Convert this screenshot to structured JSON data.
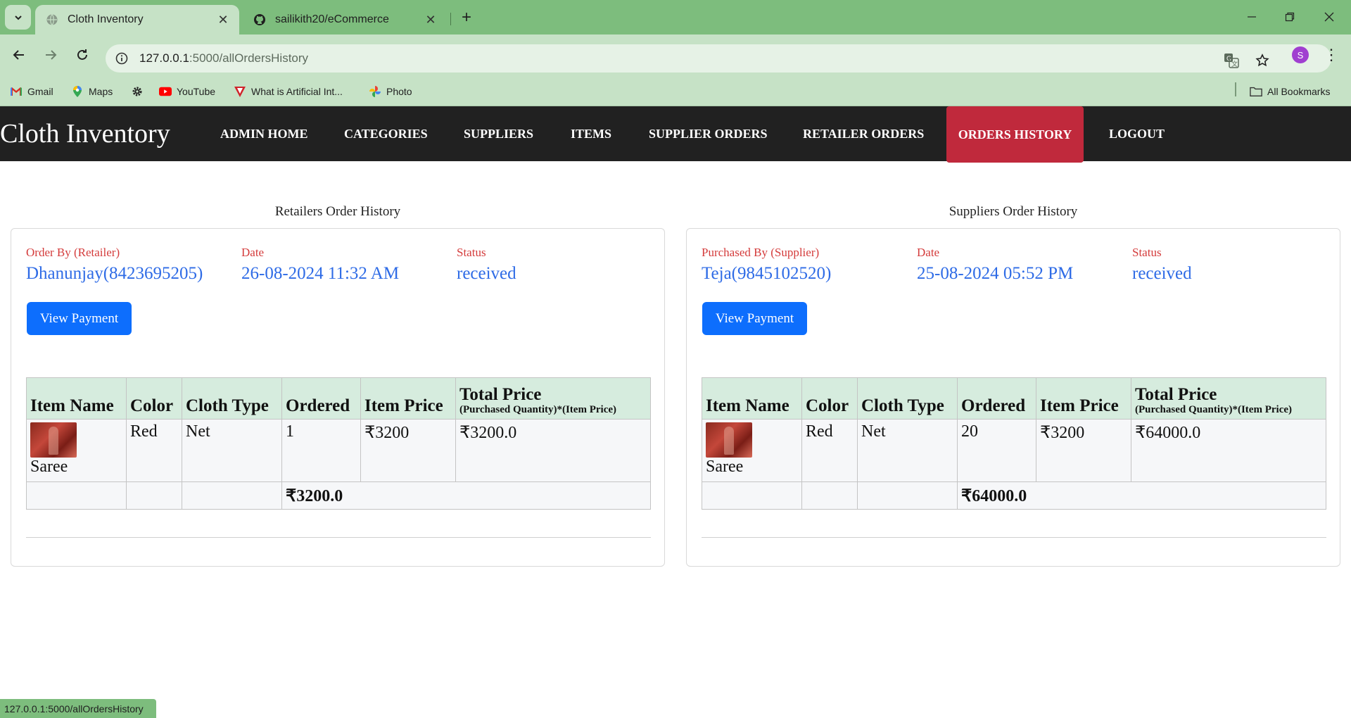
{
  "browser": {
    "tabs": [
      {
        "title": "Cloth Inventory",
        "active": true,
        "icon": "globe-icon"
      },
      {
        "title": "sailikith20/eCommerce",
        "active": false,
        "icon": "github-icon"
      }
    ],
    "url_host": "127.0.0.1",
    "url_path": ":5000/allOrdersHistory",
    "profile_initial": "S",
    "bookmarks": [
      {
        "label": "Gmail",
        "icon": "gmail-icon"
      },
      {
        "label": "Maps",
        "icon": "maps-icon"
      },
      {
        "label": "",
        "icon": "gear-icon"
      },
      {
        "label": "YouTube",
        "icon": "youtube-icon"
      },
      {
        "label": "What is Artificial Int...",
        "icon": "bookmark-v-icon"
      },
      {
        "label": "Photo",
        "icon": "photos-icon"
      }
    ],
    "all_bookmarks": "All Bookmarks",
    "status_url": "127.0.0.1:5000/allOrdersHistory",
    "accent": "#7dbd7d"
  },
  "app": {
    "brand": "Cloth Inventory",
    "nav": [
      {
        "label": "ADMIN HOME",
        "active": false
      },
      {
        "label": "CATEGORIES",
        "active": false
      },
      {
        "label": "SUPPLIERS",
        "active": false
      },
      {
        "label": "ITEMS",
        "active": false
      },
      {
        "label": "SUPPLIER ORDERS",
        "active": false
      },
      {
        "label": "RETAILER ORDERS",
        "active": false
      },
      {
        "label": "ORDERS HISTORY",
        "active": true
      },
      {
        "label": "LOGOUT",
        "active": false
      }
    ],
    "active_color": "#c0293c"
  },
  "retailers": {
    "title": "Retailers Order History",
    "order_by_label": "Order By (Retailer)",
    "order_by": "Dhanunjay(8423695205)",
    "date_label": "Date",
    "date": "26-08-2024 11:32 AM",
    "status_label": "Status",
    "status": "received",
    "button": "View Payment",
    "headers": {
      "item": "Item Name",
      "color": "Color",
      "type": "Cloth Type",
      "ordered": "Ordered",
      "price": "Item Price",
      "total": "Total Price",
      "total_sub": "(Purchased Quantity)*(Item Price)"
    },
    "row": {
      "item": "Saree",
      "color": "Red",
      "type": "Net",
      "ordered": "1",
      "price": "₹3200",
      "total": "₹3200.0"
    },
    "grand_total": "₹3200.0"
  },
  "suppliers": {
    "title": "Suppliers Order History",
    "order_by_label": "Purchased By (Supplier)",
    "order_by": "Teja(9845102520)",
    "date_label": "Date",
    "date": "25-08-2024 05:52 PM",
    "status_label": "Status",
    "status": "received",
    "button": "View Payment",
    "headers": {
      "item": "Item Name",
      "color": "Color",
      "type": "Cloth Type",
      "ordered": "Ordered",
      "price": "Item Price",
      "total": "Total Price",
      "total_sub": "(Purchased Quantity)*(Item Price)"
    },
    "row": {
      "item": "Saree",
      "color": "Red",
      "type": "Net",
      "ordered": "20",
      "price": "₹3200",
      "total": "₹64000.0"
    },
    "grand_total": "₹64000.0"
  }
}
